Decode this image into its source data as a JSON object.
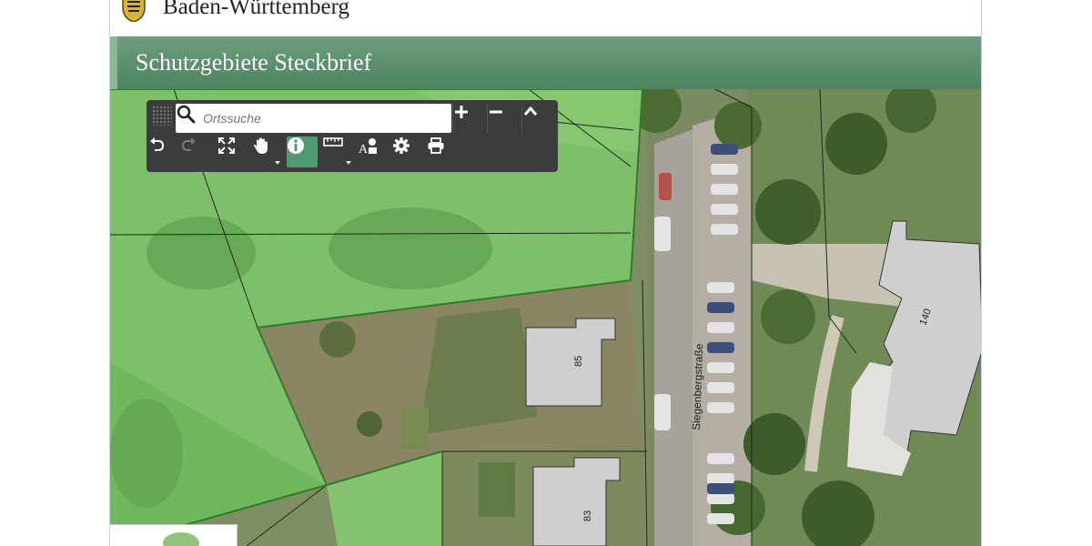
{
  "header": {
    "state_name": "Baden-Württemberg",
    "title": "Schutzgebiete Steckbrief"
  },
  "toolbar": {
    "search": {
      "placeholder": "Ortssuche",
      "value": ""
    },
    "top_buttons": [
      {
        "name": "zoom-in-button",
        "icon": "plus-icon"
      },
      {
        "name": "zoom-out-button",
        "icon": "minus-icon"
      },
      {
        "name": "collapse-toolbar-button",
        "icon": "chevron-up-icon"
      }
    ],
    "tools": [
      {
        "name": "undo-button",
        "icon": "undo-icon",
        "enabled": true
      },
      {
        "name": "redo-button",
        "icon": "redo-icon",
        "enabled": false
      },
      {
        "name": "full-extent-button",
        "icon": "expand-icon"
      },
      {
        "name": "pan-tool-button",
        "icon": "hand-icon",
        "has_menu": true
      },
      {
        "name": "info-tool-button",
        "icon": "info-icon",
        "active": true
      },
      {
        "name": "measure-tool-button",
        "icon": "ruler-icon",
        "has_menu": true
      },
      {
        "name": "label-tool-button",
        "icon": "text-shape-icon"
      },
      {
        "name": "settings-button",
        "icon": "gear-icon"
      },
      {
        "name": "print-button",
        "icon": "printer-icon"
      }
    ]
  },
  "map": {
    "street_label": "Siegenbergstraße",
    "building_labels": [
      "140",
      "85",
      "83"
    ]
  },
  "colors": {
    "titlebar": "#5a8f6b",
    "toolbar": "#3c3c3c",
    "active_tool": "#4e9a72",
    "protected_area": "#7ec46a"
  }
}
